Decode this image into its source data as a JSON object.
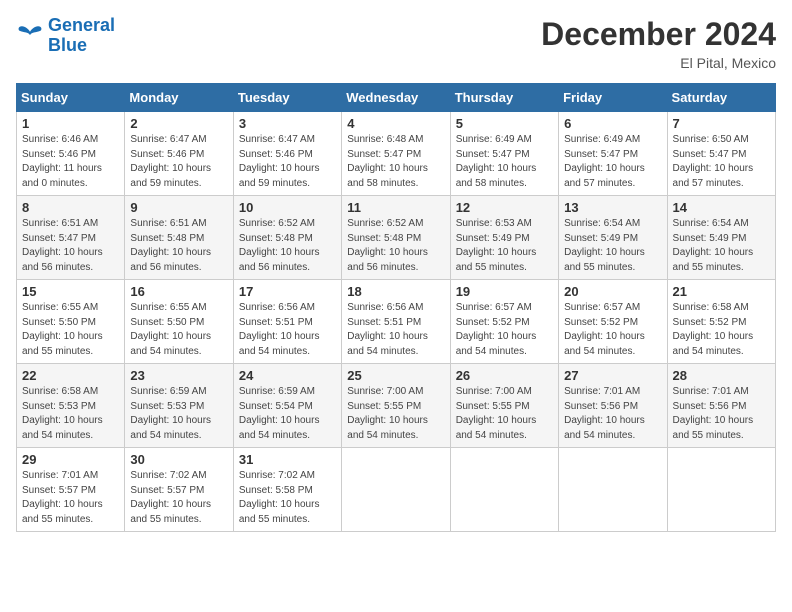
{
  "logo": {
    "line1": "General",
    "line2": "Blue"
  },
  "title": "December 2024",
  "location": "El Pital, Mexico",
  "weekdays": [
    "Sunday",
    "Monday",
    "Tuesday",
    "Wednesday",
    "Thursday",
    "Friday",
    "Saturday"
  ],
  "weeks": [
    [
      {
        "day": "1",
        "sunrise": "6:46 AM",
        "sunset": "5:46 PM",
        "daylight": "11 hours and 0 minutes."
      },
      {
        "day": "2",
        "sunrise": "6:47 AM",
        "sunset": "5:46 PM",
        "daylight": "10 hours and 59 minutes."
      },
      {
        "day": "3",
        "sunrise": "6:47 AM",
        "sunset": "5:46 PM",
        "daylight": "10 hours and 59 minutes."
      },
      {
        "day": "4",
        "sunrise": "6:48 AM",
        "sunset": "5:47 PM",
        "daylight": "10 hours and 58 minutes."
      },
      {
        "day": "5",
        "sunrise": "6:49 AM",
        "sunset": "5:47 PM",
        "daylight": "10 hours and 58 minutes."
      },
      {
        "day": "6",
        "sunrise": "6:49 AM",
        "sunset": "5:47 PM",
        "daylight": "10 hours and 57 minutes."
      },
      {
        "day": "7",
        "sunrise": "6:50 AM",
        "sunset": "5:47 PM",
        "daylight": "10 hours and 57 minutes."
      }
    ],
    [
      {
        "day": "8",
        "sunrise": "6:51 AM",
        "sunset": "5:47 PM",
        "daylight": "10 hours and 56 minutes."
      },
      {
        "day": "9",
        "sunrise": "6:51 AM",
        "sunset": "5:48 PM",
        "daylight": "10 hours and 56 minutes."
      },
      {
        "day": "10",
        "sunrise": "6:52 AM",
        "sunset": "5:48 PM",
        "daylight": "10 hours and 56 minutes."
      },
      {
        "day": "11",
        "sunrise": "6:52 AM",
        "sunset": "5:48 PM",
        "daylight": "10 hours and 56 minutes."
      },
      {
        "day": "12",
        "sunrise": "6:53 AM",
        "sunset": "5:49 PM",
        "daylight": "10 hours and 55 minutes."
      },
      {
        "day": "13",
        "sunrise": "6:54 AM",
        "sunset": "5:49 PM",
        "daylight": "10 hours and 55 minutes."
      },
      {
        "day": "14",
        "sunrise": "6:54 AM",
        "sunset": "5:49 PM",
        "daylight": "10 hours and 55 minutes."
      }
    ],
    [
      {
        "day": "15",
        "sunrise": "6:55 AM",
        "sunset": "5:50 PM",
        "daylight": "10 hours and 55 minutes."
      },
      {
        "day": "16",
        "sunrise": "6:55 AM",
        "sunset": "5:50 PM",
        "daylight": "10 hours and 54 minutes."
      },
      {
        "day": "17",
        "sunrise": "6:56 AM",
        "sunset": "5:51 PM",
        "daylight": "10 hours and 54 minutes."
      },
      {
        "day": "18",
        "sunrise": "6:56 AM",
        "sunset": "5:51 PM",
        "daylight": "10 hours and 54 minutes."
      },
      {
        "day": "19",
        "sunrise": "6:57 AM",
        "sunset": "5:52 PM",
        "daylight": "10 hours and 54 minutes."
      },
      {
        "day": "20",
        "sunrise": "6:57 AM",
        "sunset": "5:52 PM",
        "daylight": "10 hours and 54 minutes."
      },
      {
        "day": "21",
        "sunrise": "6:58 AM",
        "sunset": "5:52 PM",
        "daylight": "10 hours and 54 minutes."
      }
    ],
    [
      {
        "day": "22",
        "sunrise": "6:58 AM",
        "sunset": "5:53 PM",
        "daylight": "10 hours and 54 minutes."
      },
      {
        "day": "23",
        "sunrise": "6:59 AM",
        "sunset": "5:53 PM",
        "daylight": "10 hours and 54 minutes."
      },
      {
        "day": "24",
        "sunrise": "6:59 AM",
        "sunset": "5:54 PM",
        "daylight": "10 hours and 54 minutes."
      },
      {
        "day": "25",
        "sunrise": "7:00 AM",
        "sunset": "5:55 PM",
        "daylight": "10 hours and 54 minutes."
      },
      {
        "day": "26",
        "sunrise": "7:00 AM",
        "sunset": "5:55 PM",
        "daylight": "10 hours and 54 minutes."
      },
      {
        "day": "27",
        "sunrise": "7:01 AM",
        "sunset": "5:56 PM",
        "daylight": "10 hours and 54 minutes."
      },
      {
        "day": "28",
        "sunrise": "7:01 AM",
        "sunset": "5:56 PM",
        "daylight": "10 hours and 55 minutes."
      }
    ],
    [
      {
        "day": "29",
        "sunrise": "7:01 AM",
        "sunset": "5:57 PM",
        "daylight": "10 hours and 55 minutes."
      },
      {
        "day": "30",
        "sunrise": "7:02 AM",
        "sunset": "5:57 PM",
        "daylight": "10 hours and 55 minutes."
      },
      {
        "day": "31",
        "sunrise": "7:02 AM",
        "sunset": "5:58 PM",
        "daylight": "10 hours and 55 minutes."
      },
      null,
      null,
      null,
      null
    ]
  ],
  "labels": {
    "sunrise_prefix": "Sunrise: ",
    "sunset_prefix": "Sunset: ",
    "daylight_prefix": "Daylight: "
  }
}
